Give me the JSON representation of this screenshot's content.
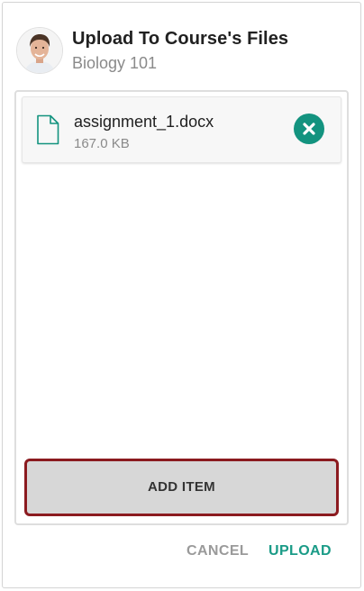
{
  "header": {
    "title": "Upload To Course's Files",
    "subtitle": "Biology 101",
    "avatar_icon": "user-avatar"
  },
  "files": [
    {
      "name": "assignment_1.docx",
      "size": "167.0 KB",
      "icon": "document-icon",
      "remove_icon": "close-icon"
    }
  ],
  "add_item_label": "ADD ITEM",
  "actions": {
    "cancel_label": "CANCEL",
    "upload_label": "UPLOAD"
  },
  "colors": {
    "accent": "#1a9b87",
    "remove_button": "#13937f",
    "highlight_border": "#8b1a1f",
    "add_item_bg": "#d7d7d7"
  }
}
